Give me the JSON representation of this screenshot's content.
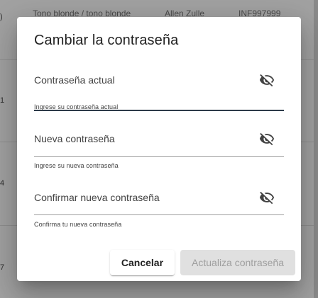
{
  "background": {
    "row_numbers": [
      ")",
      "1",
      "4",
      "7"
    ],
    "header_cells": [
      "Tono blonde / tono blonde",
      "Allen Zulle",
      "INF997999"
    ]
  },
  "dialog": {
    "title": "Cambiar la contraseña",
    "fields": [
      {
        "label": "Contraseña actual",
        "hint": "Ingrese su contraseña actual",
        "icon": "eye-off-icon"
      },
      {
        "label": "Nueva contraseña",
        "hint": "Ingrese su nueva contraseña",
        "icon": "eye-off-icon"
      },
      {
        "label": "Confirmar nueva contraseña",
        "hint": "Confirma tu nueva contraseña",
        "icon": "eye-off-icon"
      }
    ],
    "cancel_label": "Cancelar",
    "update_label": "Actualiza contraseña"
  },
  "colors": {
    "focused_underline": "#2d3a4a",
    "disabled_button_bg": "#e0e0e0",
    "disabled_button_text": "#9e9e9e"
  }
}
